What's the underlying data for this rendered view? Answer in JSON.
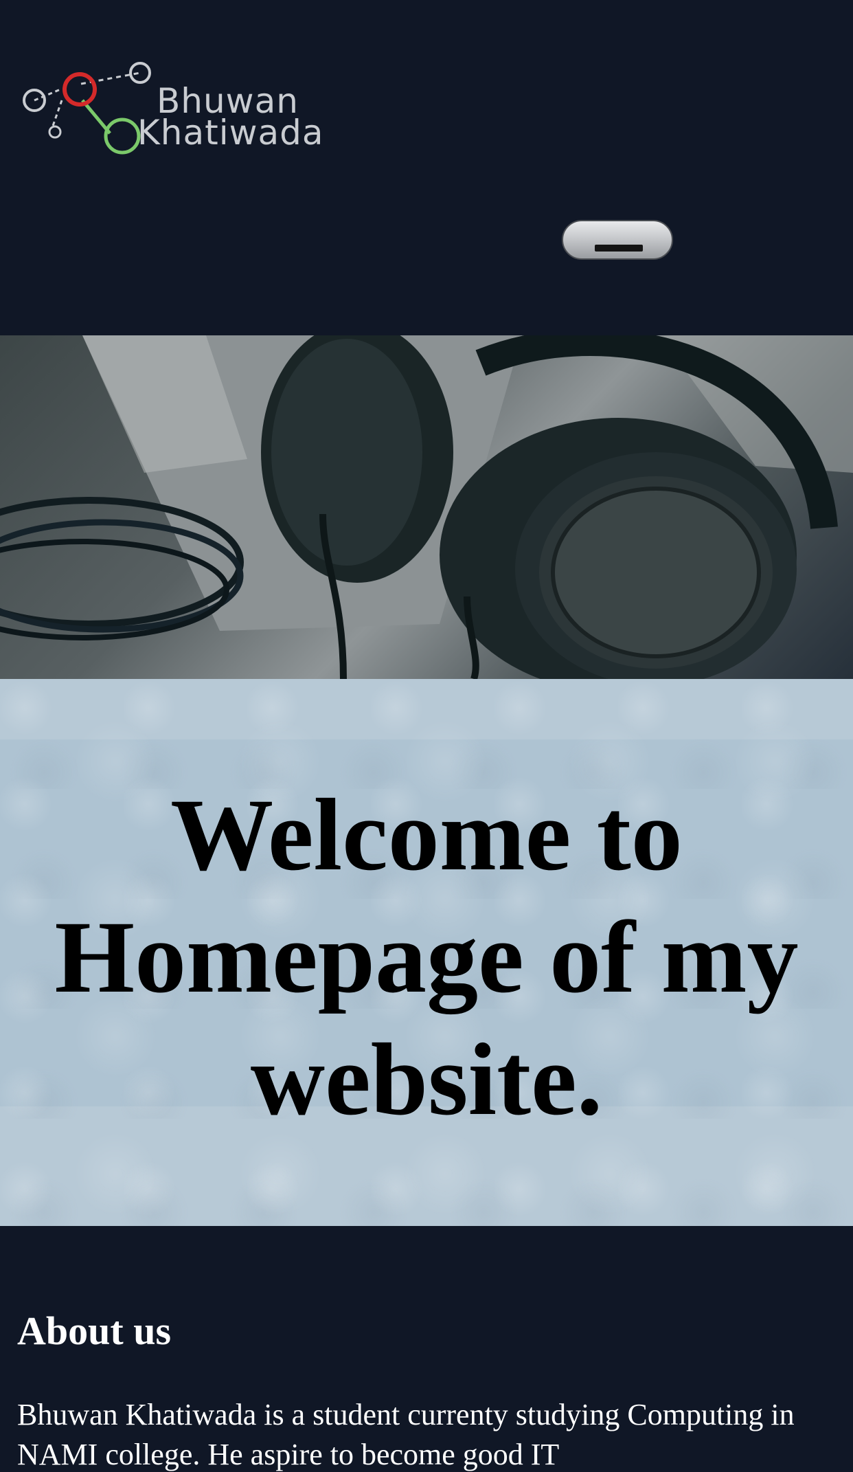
{
  "header": {
    "logo": {
      "line1": "Bhuwan",
      "line2": "Khatiwada"
    },
    "menu_button_icon": "hamburger-bar-icon"
  },
  "hero": {
    "image_subject": "headphones-photo"
  },
  "welcome": {
    "title": "Welcome to Homepage of my website."
  },
  "about": {
    "heading": "About us",
    "text": "Bhuwan Khatiwada is a student currenty studying Computing in NAMI college. He aspire to become good IT"
  },
  "colors": {
    "page_background": "#101726",
    "welcome_background": "#b7c9d6",
    "logo_red": "#d42a2a",
    "logo_green": "#7bc96a",
    "logo_gray": "#c9ccd1"
  }
}
